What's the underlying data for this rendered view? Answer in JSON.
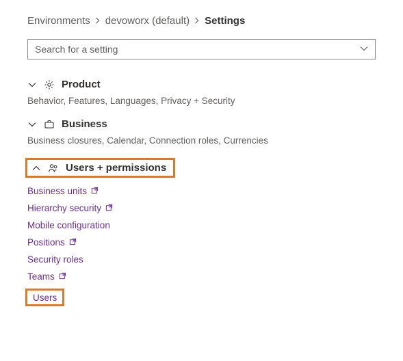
{
  "breadcrumb": {
    "item0": "Environments",
    "item1": "devoworx (default)",
    "item2": "Settings"
  },
  "search": {
    "placeholder": "Search for a setting"
  },
  "sections": {
    "product": {
      "title": "Product",
      "subtitle": "Behavior, Features, Languages, Privacy + Security"
    },
    "business": {
      "title": "Business",
      "subtitle": "Business closures, Calendar, Connection roles, Currencies"
    },
    "usersPermissions": {
      "title": "Users + permissions",
      "links": {
        "0": "Business units",
        "1": "Hierarchy security",
        "2": "Mobile configuration",
        "3": "Positions",
        "4": "Security roles",
        "5": "Teams",
        "6": "Users"
      }
    }
  }
}
